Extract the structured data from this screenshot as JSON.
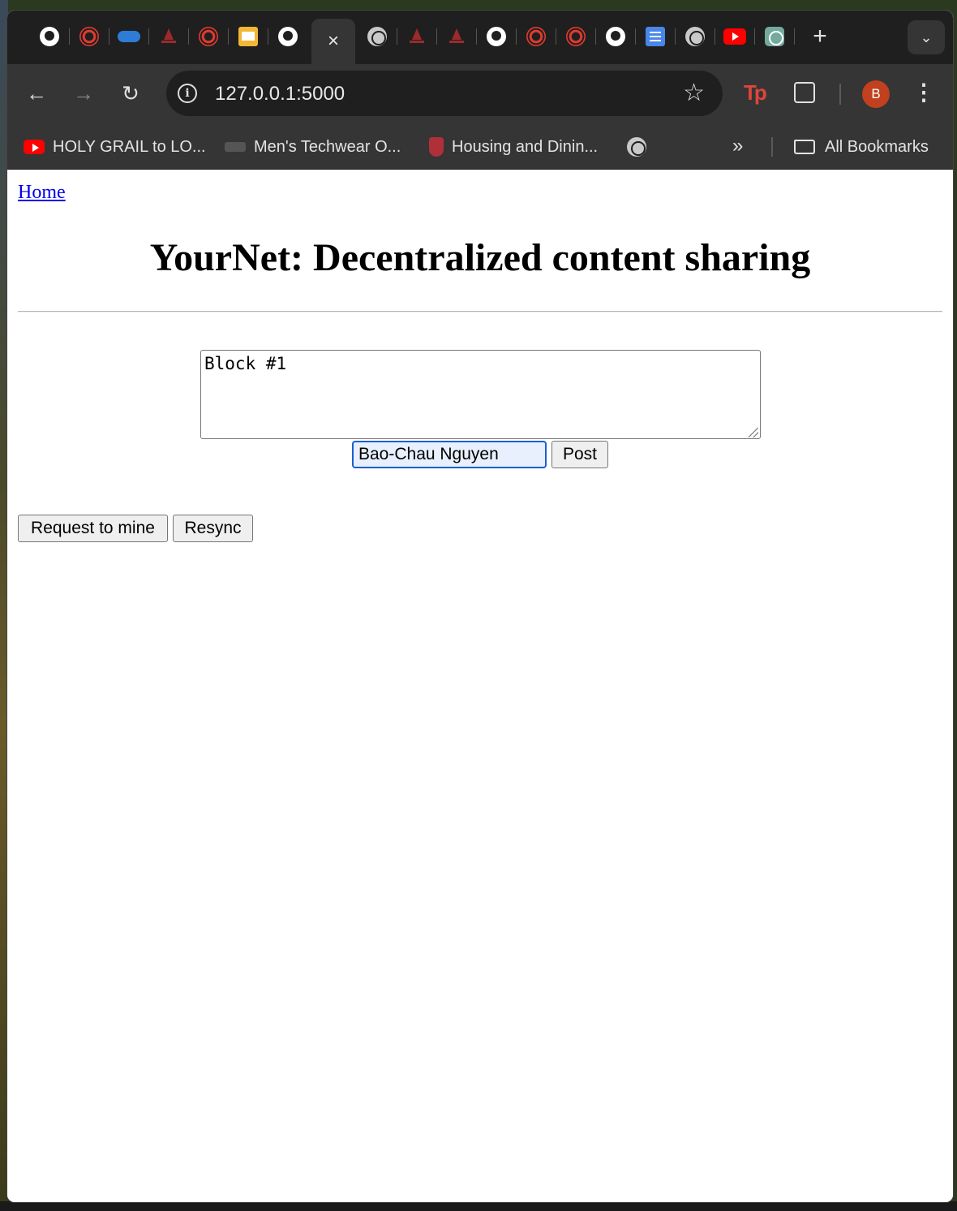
{
  "browser": {
    "tabs": [
      {
        "icon": "github-icon"
      },
      {
        "icon": "canvas-icon"
      },
      {
        "icon": "onedrive-icon"
      },
      {
        "icon": "stevens-icon"
      },
      {
        "icon": "canvas-icon"
      },
      {
        "icon": "google-slides-icon"
      },
      {
        "icon": "github-icon"
      },
      {
        "icon": "close-icon",
        "active": true
      },
      {
        "icon": "globe-icon"
      },
      {
        "icon": "stevens-icon"
      },
      {
        "icon": "stevens-icon"
      },
      {
        "icon": "github-icon"
      },
      {
        "icon": "canvas-icon"
      },
      {
        "icon": "canvas-icon"
      },
      {
        "icon": "github-icon"
      },
      {
        "icon": "google-docs-icon"
      },
      {
        "icon": "globe-icon"
      },
      {
        "icon": "youtube-icon"
      },
      {
        "icon": "chatgpt-icon"
      }
    ],
    "active_tab_close": "×",
    "new_tab": "+",
    "tab_search": "⌄",
    "url": "127.0.0.1:5000",
    "profile_initial": "B",
    "extension_tp": "Tp",
    "bookmarks": [
      {
        "label": "HOLY GRAIL to LO...",
        "icon": "youtube-icon"
      },
      {
        "label": "Men's Techwear O...",
        "icon": "techwear-icon"
      },
      {
        "label": "Housing and Dinin...",
        "icon": "shield-icon"
      },
      {
        "label": "",
        "icon": "globe-icon"
      }
    ],
    "bookmarks_overflow": "»",
    "all_bookmarks": "All Bookmarks",
    "accent_color": "#1a5fd0",
    "avatar_color": "#c1401e"
  },
  "page": {
    "home_link": "Home",
    "title": "YourNet: Decentralized content sharing",
    "content_value": "Block #1",
    "author_value": "Bao-Chau Nguyen",
    "post_label": "Post",
    "mine_label": "Request to mine",
    "resync_label": "Resync"
  }
}
